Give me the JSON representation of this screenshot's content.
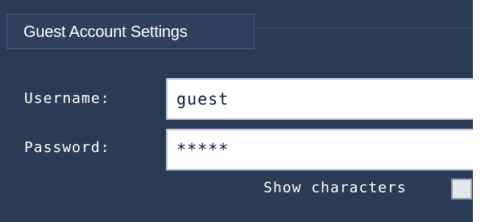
{
  "section": {
    "title": "Guest Account Settings"
  },
  "form": {
    "username_label": "Username:",
    "username_value": "guest",
    "password_label": "Password:",
    "password_value": "*****",
    "show_characters_label": "Show characters",
    "show_characters_checked": false
  },
  "colors": {
    "panel_background": "#2b3a55",
    "text": "#ffffff",
    "field_background": "#ffffff",
    "field_border": "#b9c3d4"
  }
}
